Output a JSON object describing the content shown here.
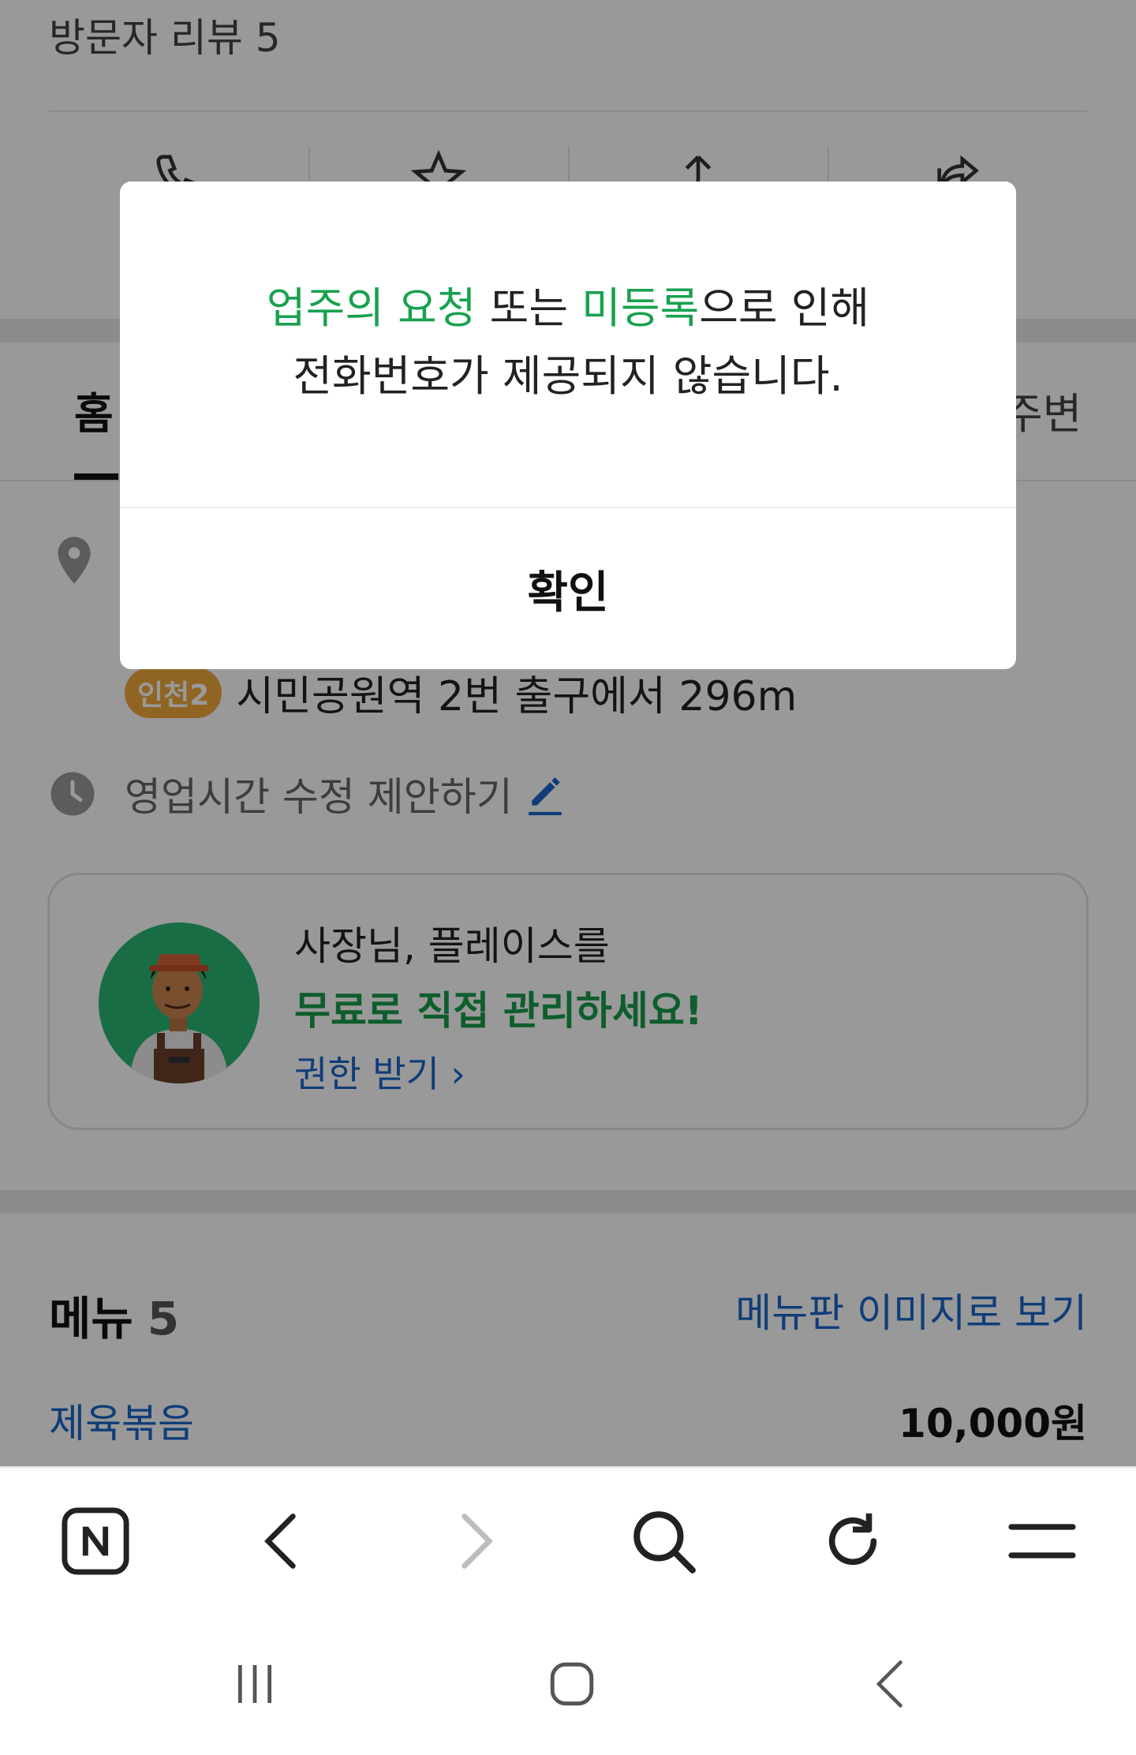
{
  "header": {
    "review_count": "방문자 리뷰 5"
  },
  "tabs": {
    "home": "홈",
    "nearby": "주변"
  },
  "location": {
    "subway_line": "인천2",
    "subway_text": "시민공원역 2번 출구에서 296m"
  },
  "hours": {
    "label": "영업시간 수정 제안하기"
  },
  "owner_card": {
    "line1": "사장님, 플레이스를",
    "line2": "무료로 직접 관리하세요!",
    "link": "권한 받기"
  },
  "menu": {
    "title": "메뉴",
    "count": "5",
    "image_link": "메뉴판 이미지로 보기",
    "items": [
      {
        "name": "제육볶음",
        "price": "10,000원"
      }
    ]
  },
  "dialog": {
    "msg_part1": "업주의 요청",
    "msg_part2": " 또는 ",
    "msg_part3": "미등록",
    "msg_part4": "으로 인해",
    "msg_line2": "전화번호가 제공되지 않습니다.",
    "confirm": "확인"
  },
  "colors": {
    "accent_green": "#1aa14f",
    "link_blue": "#1a66c9",
    "subway_badge": "#f0a93c"
  },
  "icons": {
    "toolbar": [
      "naver-home-icon",
      "back-icon",
      "forward-icon",
      "search-icon",
      "refresh-icon",
      "menu-icon"
    ],
    "system": [
      "recent-apps-icon",
      "home-icon",
      "system-back-icon"
    ]
  }
}
